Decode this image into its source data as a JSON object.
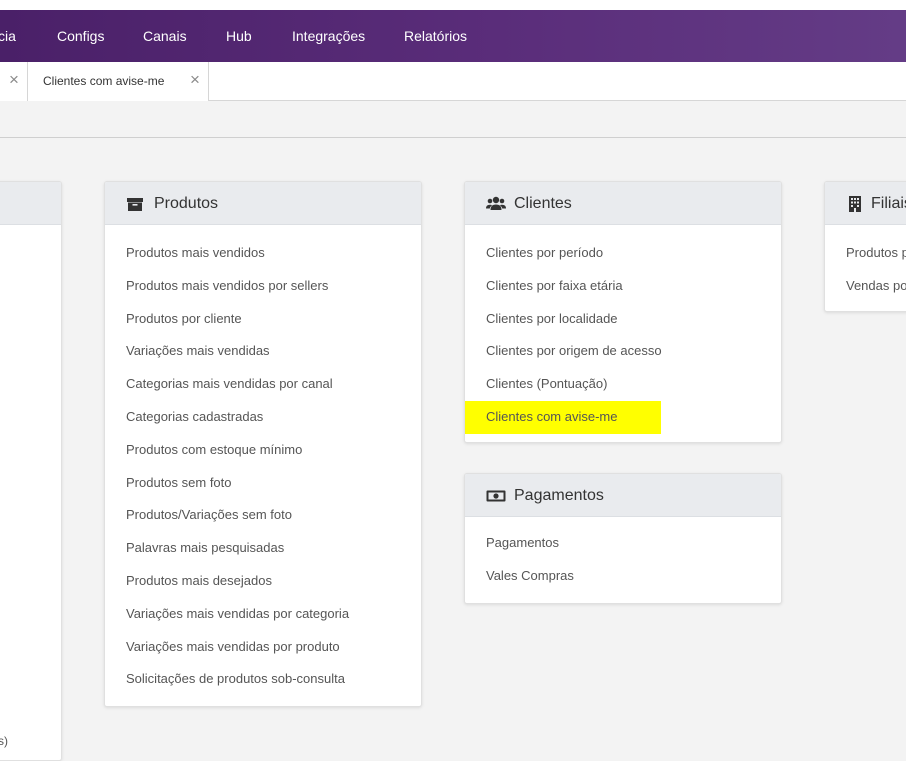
{
  "nav": {
    "items": [
      "cia",
      "Configs",
      "Canais",
      "Hub",
      "Integrações",
      "Relatórios"
    ]
  },
  "tabs": {
    "second_label": "Clientes com avise-me",
    "close_glyph": "×"
  },
  "cards": {
    "produtos": {
      "title": "Produtos",
      "icon": "archive-box-icon",
      "links": [
        "Produtos mais vendidos",
        "Produtos mais vendidos por sellers",
        "Produtos por cliente",
        "Variações mais vendidas",
        "Categorias mais vendidas por canal",
        "Categorias cadastradas",
        "Produtos com estoque mínimo",
        "Produtos sem foto",
        "Produtos/Variações sem foto",
        "Palavras mais pesquisadas",
        "Produtos mais desejados",
        "Variações mais vendidas por categoria",
        "Variações mais vendidas por produto",
        "Solicitações de produtos sob-consulta"
      ]
    },
    "clientes": {
      "title": "Clientes",
      "icon": "users-icon",
      "links": [
        "Clientes por período",
        "Clientes por faixa etária",
        "Clientes por localidade",
        "Clientes por origem de acesso",
        "Clientes (Pontuação)",
        "Clientes com avise-me"
      ],
      "highlight_color": "#ffff00"
    },
    "pagamentos": {
      "title": "Pagamentos",
      "icon": "money-bill-icon",
      "links": [
        "Pagamentos",
        "Vales Compras"
      ]
    },
    "filiais": {
      "title": "Filiais",
      "icon": "building-icon",
      "links": [
        "Produtos p",
        "Vendas po"
      ]
    }
  },
  "bottom_fragment": "s)",
  "colors": {
    "navbar": "#5a2d7a",
    "highlight": "#ffff00",
    "card_header": "#e9ebee"
  }
}
